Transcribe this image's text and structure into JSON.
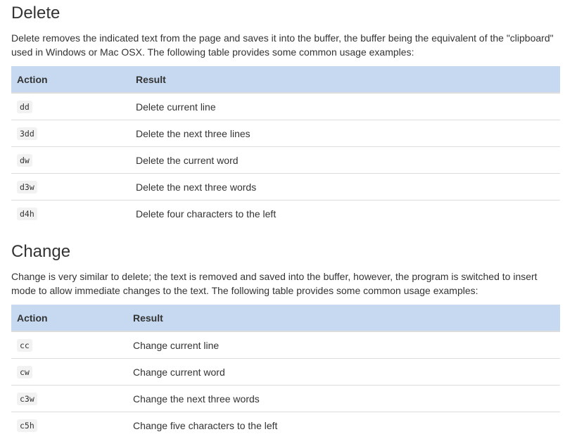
{
  "sections": {
    "delete": {
      "heading": "Delete",
      "description": "Delete removes the indicated text from the page and saves it into the buffer, the buffer being the equivalent of the \"clipboard\" used in Windows or Mac OSX. The following table provides some common usage examples:",
      "columns": [
        "Action",
        "Result"
      ],
      "rows": [
        {
          "action": "dd",
          "result": "Delete current line"
        },
        {
          "action": "3dd",
          "result": "Delete the next three lines"
        },
        {
          "action": "dw",
          "result": "Delete the current word"
        },
        {
          "action": "d3w",
          "result": "Delete the next three words"
        },
        {
          "action": "d4h",
          "result": "Delete four characters to the left"
        }
      ]
    },
    "change": {
      "heading": "Change",
      "description": "Change is very similar to delete; the text is removed and saved into the buffer, however, the program is switched to insert mode to allow immediate changes to the text. The following table provides some common usage examples:",
      "columns": [
        "Action",
        "Result"
      ],
      "rows": [
        {
          "action": "cc",
          "result": "Change current line"
        },
        {
          "action": "cw",
          "result": "Change current word"
        },
        {
          "action": "c3w",
          "result": "Change the next three words"
        },
        {
          "action": "c5h",
          "result": "Change five characters to the left"
        }
      ]
    }
  }
}
